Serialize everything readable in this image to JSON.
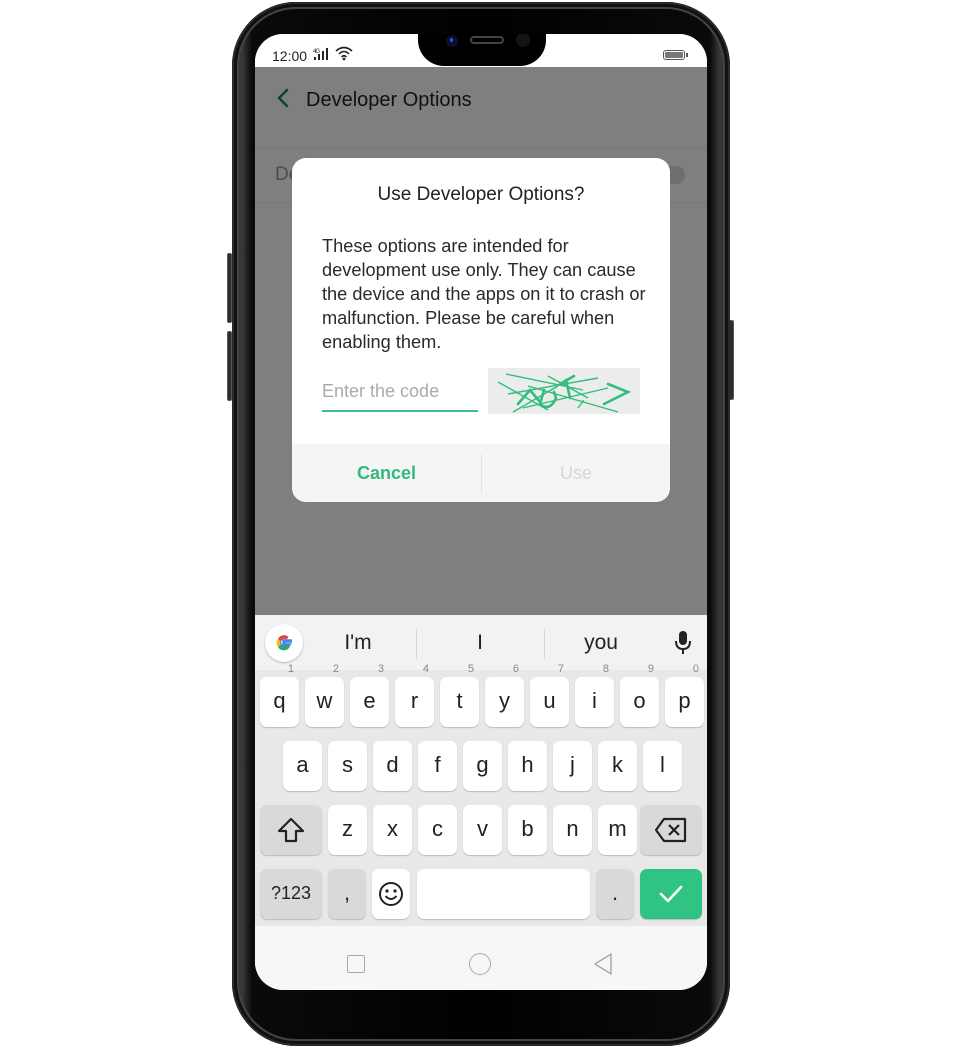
{
  "status_bar": {
    "time": "12:00",
    "signal_label": "4G",
    "icons": [
      "signal-icon",
      "wifi-icon",
      "battery-icon"
    ]
  },
  "app_bar": {
    "back_icon": "chevron-left-icon",
    "title": "Developer Options"
  },
  "background_setting": {
    "label": "Developer Options"
  },
  "dialog": {
    "title": "Use Developer Options?",
    "body": "These options are intended for development use only. They can cause the device and the apps on it to crash or malfunction. Please be careful when enabling them.",
    "code_input": {
      "value": "",
      "placeholder": "Enter the code"
    },
    "captcha_icon": "captcha-image",
    "cancel_label": "Cancel",
    "use_label": "Use"
  },
  "keyboard": {
    "suggestions": [
      "I'm",
      "I",
      "you"
    ],
    "row1": [
      {
        "k": "q",
        "h": "1"
      },
      {
        "k": "w",
        "h": "2"
      },
      {
        "k": "e",
        "h": "3"
      },
      {
        "k": "r",
        "h": "4"
      },
      {
        "k": "t",
        "h": "5"
      },
      {
        "k": "y",
        "h": "6"
      },
      {
        "k": "u",
        "h": "7"
      },
      {
        "k": "i",
        "h": "8"
      },
      {
        "k": "o",
        "h": "9"
      },
      {
        "k": "p",
        "h": "0"
      }
    ],
    "row2": [
      "a",
      "s",
      "d",
      "f",
      "g",
      "h",
      "j",
      "k",
      "l"
    ],
    "row3": [
      "z",
      "x",
      "c",
      "v",
      "b",
      "n",
      "m"
    ],
    "symbols_label": "?123",
    "comma": ",",
    "period": "."
  },
  "colors": {
    "accent": "#33b97a",
    "enter_key": "#2fc483",
    "scrim": "#808080"
  }
}
